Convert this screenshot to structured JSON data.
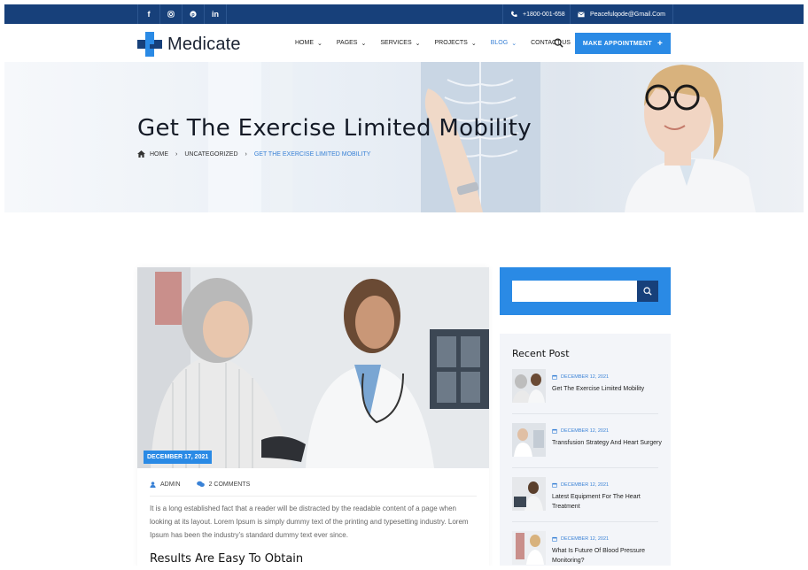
{
  "topbar": {
    "social": [
      "f",
      "ig",
      "p",
      "in"
    ],
    "phone": "+1800-001-658",
    "email": "Peacefulqode@Gmail.Com"
  },
  "header": {
    "logo_text": "Medicate",
    "nav": [
      {
        "label": "HOME",
        "has_menu": true
      },
      {
        "label": "PAGES",
        "has_menu": true
      },
      {
        "label": "SERVICES",
        "has_menu": true
      },
      {
        "label": "PROJECTS",
        "has_menu": true
      },
      {
        "label": "BLOG",
        "has_menu": true,
        "active": true
      },
      {
        "label": "CONTACT US",
        "has_menu": false
      }
    ],
    "cta": "MAKE APPOINTMENT"
  },
  "hero": {
    "title": "Get The Exercise Limited Mobility",
    "breadcrumb": [
      "HOME",
      "UNCATEGORIZED",
      "GET THE EXERCISE LIMITED MOBILITY"
    ]
  },
  "post": {
    "date": "DECEMBER 17, 2021",
    "author": "ADMIN",
    "comments": "2 COMMENTS",
    "excerpt": "It is a long established fact that a reader will be distracted by the readable content of a page when looking at its layout. Lorem Ipsum is simply dummy text of the printing and typesetting industry. Lorem Ipsum has been the industry’s standard dummy text ever since.",
    "subheading": "Results Are Easy To Obtain"
  },
  "sidebar": {
    "search_placeholder": "",
    "recent_title": "Recent Post",
    "recent_posts": [
      {
        "date": "DECEMBER 12, 2021",
        "title": "Get The Exercise Limited Mobility"
      },
      {
        "date": "DECEMBER 12, 2021",
        "title": "Transfusion Strategy And Heart Surgery"
      },
      {
        "date": "DECEMBER 12, 2021",
        "title": "Latest Equipment For The Heart Treatment"
      },
      {
        "date": "DECEMBER 12, 2021",
        "title": "What Is Future Of Blood Pressure Monitoring?"
      }
    ]
  },
  "colors": {
    "topbar": "#17407a",
    "accent": "#2a8ae5",
    "link": "#3a82d6"
  }
}
